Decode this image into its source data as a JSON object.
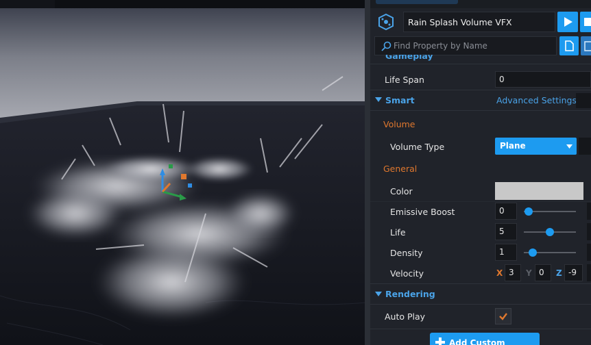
{
  "properties": {
    "object_name": "Rain Splash Volume VFX",
    "search_placeholder": "Find Property by Name",
    "sections": {
      "gameplay": "Gameplay",
      "smart": "Smart",
      "rendering": "Rendering"
    },
    "life_span": {
      "label": "Life Span",
      "value": "0"
    },
    "advanced_settings": "Advanced Settings",
    "volume_group": "Volume",
    "volume_type": {
      "label": "Volume Type",
      "value": "Plane"
    },
    "general_group": "General",
    "color": {
      "label": "Color",
      "swatch": "#c8c8c8"
    },
    "emissive_boost": {
      "label": "Emissive Boost",
      "value": "0",
      "slider": 0.0
    },
    "life": {
      "label": "Life",
      "value": "5",
      "slider": 0.5
    },
    "density": {
      "label": "Density",
      "value": "1",
      "slider": 0.1
    },
    "velocity": {
      "label": "Velocity",
      "x_label": "X",
      "x": "3",
      "y_label": "Y",
      "y": "0",
      "z_label": "Z",
      "z": "-9"
    },
    "auto_play": {
      "label": "Auto Play",
      "checked": true
    },
    "add_custom_property": "Add Custom Property"
  },
  "colors": {
    "accent_blue": "#1d9bf0",
    "section_blue": "#4aa3e8",
    "group_orange": "#e0782e",
    "axis_x": "#e0782e",
    "axis_y": "#6b7078",
    "axis_z": "#4aa3e8"
  },
  "icons": {
    "object": "vfx-object-icon",
    "play": "play-icon",
    "stop": "stop-icon",
    "search": "search-icon",
    "copy": "copy-icon",
    "paste": "paste-icon",
    "dropdown": "chevron-down-icon",
    "checkbox": "checkmark-icon",
    "add": "plus-icon",
    "expand": "triangle-down-icon"
  }
}
